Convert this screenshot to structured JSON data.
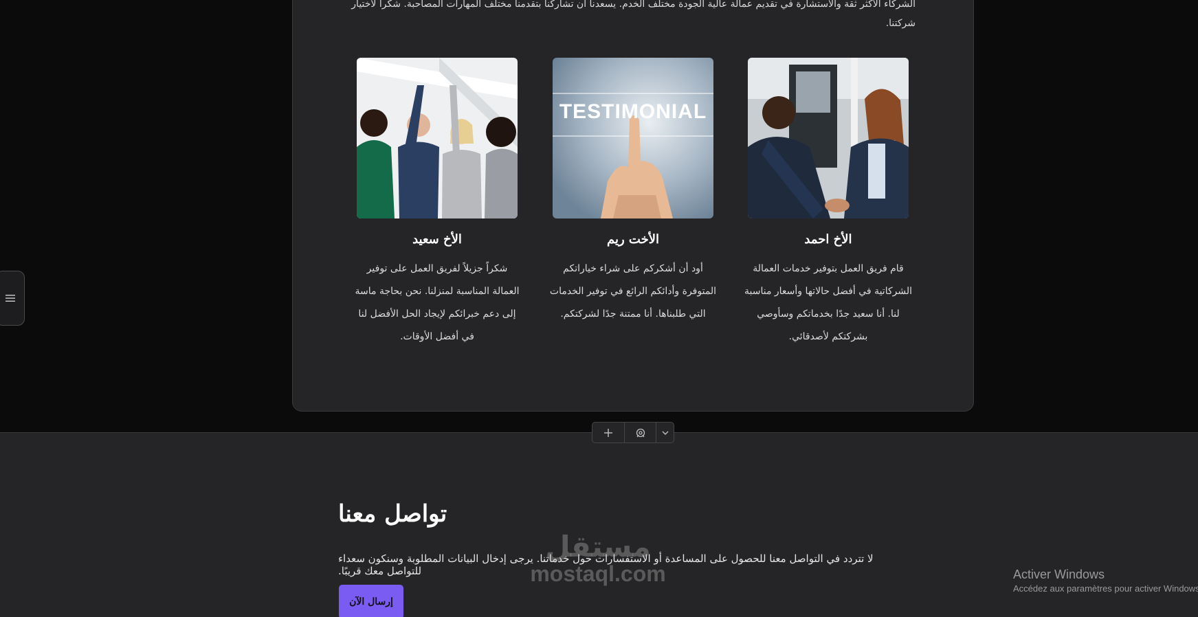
{
  "intro_text": "الشركاء الأكثر ثقة والاستشارة في تقديم عمالة عالية الجودة مختلف الخدم. يسعدنا أن تشاركنا بتقدمنا مختلف المهارات المصاحبة. شكراً لاختيار شركتنا.",
  "testimonials": [
    {
      "name": "الأخ احمد",
      "text": "قام فريق العمل بتوفير خدمات العمالة الشركاتية في أفضل حالاتها وأسعار مناسبة لنا. أنا سعيد جدًا بخدماتكم وسأوصي بشركتكم لأصدقائي.",
      "image": "handshake-photo"
    },
    {
      "name": "الأخت ريم",
      "text": "أود أن أشكركم على شراء خياراتكم المتوفرة وأدائكم الرائع في توفير الخدمات التي طلبناها. أنا ممتنة جدًا لشركتكم.",
      "image": "testimonial-photo",
      "image_caption": "TESTIMONIAL"
    },
    {
      "name": "الأخ سعيد",
      "text": "شكراً جزيلاً لفريق العمل على توفير العمالة المناسبة لمنزلنا. نحن بحاجة ماسة إلى دعم خبرائكم لإيجاد الحل الأفضل لنا في أفضل الأوقات.",
      "image": "team-celebrating-photo"
    }
  ],
  "contact": {
    "title": "تواصل معنا",
    "text": "لا تتردد في التواصل معنا للحصول على المساعدة أو الاستفسارات حول خدماتنا. يرجى إدخال البيانات المطلوبة وسنكون سعداء للتواصل معك قريبًا.",
    "button": "إرسال الآن"
  },
  "toolbar": {
    "icons": [
      "plus-icon",
      "settings-icon",
      "chevron-down-icon"
    ]
  },
  "side_toggle_icon": "menu-icon",
  "watermark": {
    "arabic": "مستقل",
    "latin": "mostaql.com"
  },
  "windows_activation": {
    "title": "Activer Windows",
    "subtitle": "Accédez aux paramètres pour activer Windows."
  },
  "colors": {
    "page_bg": "#0b0b0c",
    "card_bg": "#252527",
    "accent": "#7a5cf3"
  }
}
